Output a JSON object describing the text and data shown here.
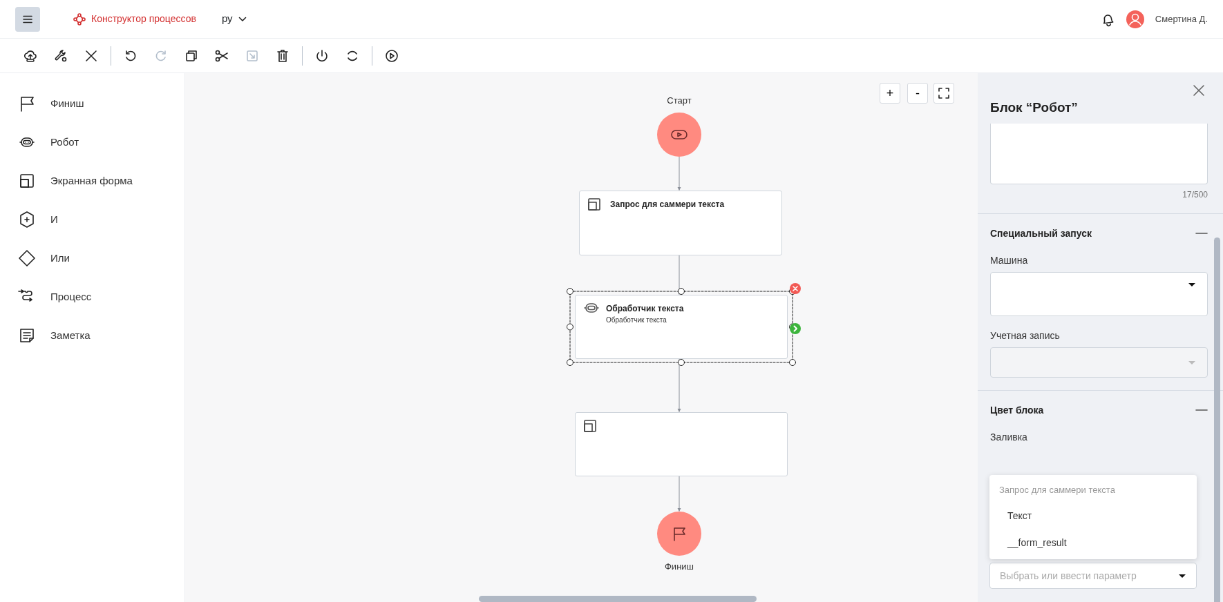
{
  "header": {
    "app_title": "Конструктор процессов",
    "language": "ру",
    "user_name": "Смертина Д."
  },
  "toolbar_groups": [
    [
      {
        "disabled": false
      },
      {
        "disabled": false
      },
      {
        "disabled": false
      }
    ],
    [
      {
        "disabled": false
      },
      {
        "disabled": true
      },
      {
        "disabled": false
      },
      {
        "disabled": false
      },
      {
        "disabled": true
      },
      {
        "disabled": false
      }
    ],
    [
      {
        "disabled": false
      },
      {
        "disabled": false
      }
    ],
    [
      {
        "disabled": false
      }
    ]
  ],
  "palette": [
    {
      "label": "Финиш"
    },
    {
      "label": "Робот"
    },
    {
      "label": "Экранная форма"
    },
    {
      "label": "И"
    },
    {
      "label": "Или"
    },
    {
      "label": "Процесс"
    },
    {
      "label": "Заметка"
    }
  ],
  "canvas": {
    "zoom_buttons": [
      "+",
      "-"
    ],
    "start_label": "Старт",
    "finish_label": "Финиш",
    "nodes": [
      {
        "kind": "form",
        "title": "Запрос для саммери текста",
        "selected": false
      },
      {
        "kind": "robot",
        "title": "Обработчик текста",
        "subtitle": "Обработчик текста",
        "selected": true
      },
      {
        "kind": "form",
        "selected": false
      }
    ]
  },
  "panel": {
    "title": "Блок “Робот”",
    "counter": "17/500",
    "sections": [
      {
        "title": "Специальный запуск",
        "expanded": true,
        "fields": [
          {
            "label": "Машина",
            "disabled": false
          },
          {
            "label": "Учетная запись",
            "disabled": true
          }
        ]
      },
      {
        "title": "Цвет блока",
        "expanded": true,
        "fields": [
          {
            "label": "Заливка",
            "kind": "color"
          }
        ]
      }
    ],
    "dropdown": {
      "group": "Запрос для саммери текста",
      "options": [
        "Текст",
        "__form_result"
      ]
    },
    "param_select": {
      "placeholder": "Выбрать или ввести параметр"
    }
  }
}
